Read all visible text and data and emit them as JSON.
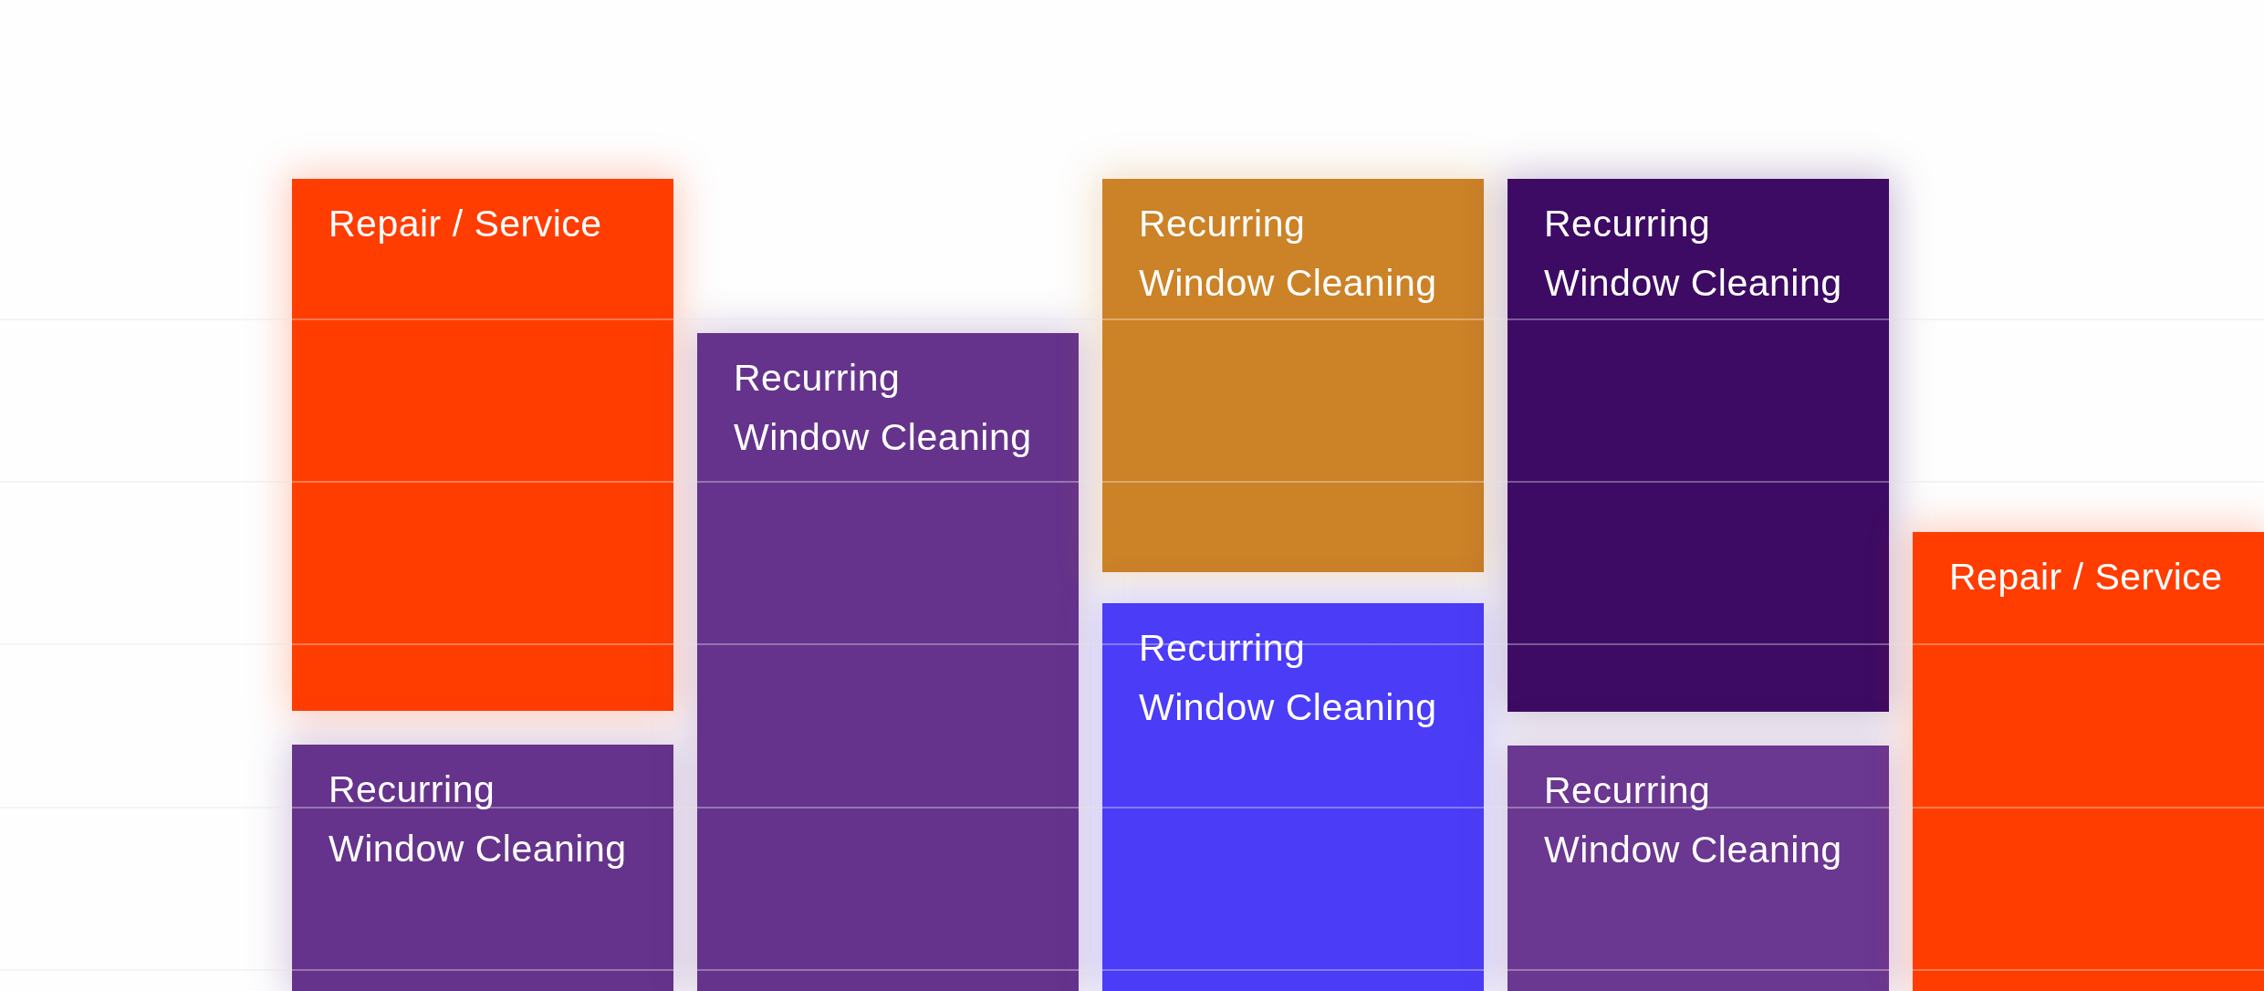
{
  "calendar": {
    "columns": [
      {
        "events": [
          {
            "title": "Repair / Service",
            "color": "#ff3d00"
          },
          {
            "title": "Recurring\nWindow Cleaning",
            "color": "#65338b"
          }
        ]
      },
      {
        "events": [
          {
            "title": "Recurring\nWindow Cleaning",
            "color": "#65338b"
          }
        ]
      },
      {
        "events": [
          {
            "title": "Recurring\nWindow Cleaning",
            "color": "#cc8227"
          },
          {
            "title": "Recurring\nWindow Cleaning",
            "color": "#4b3cf7"
          }
        ]
      },
      {
        "events": [
          {
            "title": "Recurring\nWindow Cleaning",
            "color": "#3d0b63"
          },
          {
            "title": "Recurring\nWindow Cleaning",
            "color": "#6a3791"
          }
        ]
      },
      {
        "events": [
          {
            "title": "Repair / Service",
            "color": "#ff3d00"
          }
        ]
      }
    ]
  }
}
